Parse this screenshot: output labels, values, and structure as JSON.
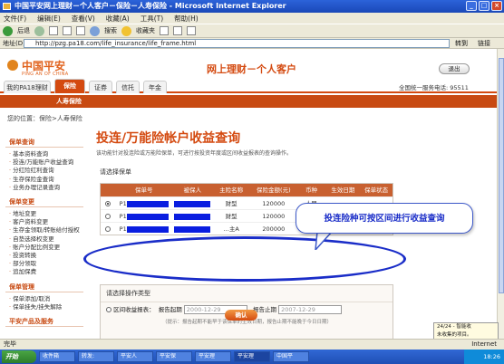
{
  "window": {
    "title": "中国平安网上理财－个人客户－保险－人寿保险 - Microsoft Internet Explorer"
  },
  "menu": [
    "文件(F)",
    "编辑(E)",
    "查看(V)",
    "收藏(A)",
    "工具(T)",
    "帮助(H)"
  ],
  "toolbar": {
    "back": "后退",
    "search": "搜索",
    "favorites": "收藏夹"
  },
  "address": {
    "label": "地址(D)",
    "url": "http://pzg.pa18.com/life_insurance/life_frame.html",
    "go": "转到",
    "links": "链接"
  },
  "banner": {
    "logo_cn": "中国平安",
    "logo_en": "PING AN OF CHINA",
    "title": "网上理财－个人客户",
    "exit": "退出",
    "hotline": "全国统一服务电话: 95511"
  },
  "nav": {
    "tabs": [
      "我的PA18理财",
      "保险",
      "证券",
      "信托",
      "年金"
    ],
    "active_index": 1
  },
  "subnav": {
    "label": "人寿保险"
  },
  "breadcrumb": "您的位置：保险>人寿保险",
  "sidebar": {
    "sections": [
      {
        "title": "保单查询",
        "items": [
          "基本资料查询",
          "投连/万能账户收益查询",
          "分红险红利查询",
          "生存保险金查询",
          "业务办理记录查询"
        ]
      },
      {
        "title": "保单变更",
        "items": [
          "地址变更",
          "客户资料变更",
          "生存金领取/转账给付授权",
          "自垫选择权变更",
          "账户分配比例变更",
          "投资转换",
          "部分领取",
          "追加保费"
        ]
      },
      {
        "title": "保单管理",
        "items": [
          "保单添加/取消",
          "保单挂失/挂失解除"
        ]
      },
      {
        "title": "平安产品及服务",
        "items": []
      }
    ]
  },
  "main": {
    "title": "投连/万能险帐户收益查询",
    "desc": "该功能针对投连险或万能险保单，可进行按投资年度或区间收益报表的查询操作。",
    "select_policy_label": "请选择保单",
    "columns": [
      "保单号",
      "被保人",
      "主险名称",
      "保险金额(元)",
      "币种",
      "生效日期",
      "保单状态"
    ],
    "rows": [
      {
        "policy_no": "P1",
        "product": "财型",
        "amount": "120000",
        "currency": "人民",
        "selected": true
      },
      {
        "policy_no": "P1",
        "product": "财型",
        "amount": "120000",
        "currency": "人民",
        "selected": false
      },
      {
        "policy_no": "P1",
        "product": "…主A",
        "amount": "200000",
        "currency": "人民",
        "selected": false
      }
    ],
    "select_op_label": "请选择操作类型",
    "option_label": "区间收益报表：",
    "start_label": "报告起期",
    "start_value": "2000-12-29",
    "end_label": "报告止期",
    "end_value": "2007-12-29",
    "hint": "（提示：报告起期不能早于该保单的生效日期，报告止期不能晚于今日日期）",
    "confirm": "确认"
  },
  "callout": "投连险种可按区间进行收益查询",
  "status": {
    "left": "完毕",
    "right": "Internet"
  },
  "notification": {
    "line1": "24/24 - 智能收",
    "line2": "未收集的项目。"
  },
  "taskbar": {
    "start": "开始",
    "tasks": [
      "收件箱",
      "转发:",
      "平安人",
      "平安保",
      "平安理",
      "平安理",
      "中国平"
    ],
    "clock": "18:26"
  }
}
